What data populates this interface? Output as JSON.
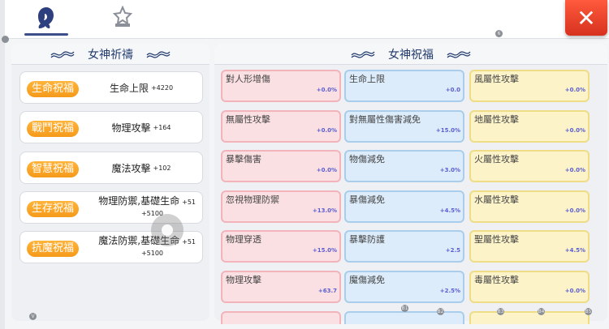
{
  "close_label": "✕",
  "left_panel": {
    "title": "女神祈禱",
    "rows": [
      {
        "badge": "生命祝福",
        "stat": "生命上限",
        "value": "+4220"
      },
      {
        "badge": "戰鬥祝福",
        "stat": "物理攻擊",
        "value": "+164"
      },
      {
        "badge": "智慧祝福",
        "stat": "魔法攻擊",
        "value": "+102"
      },
      {
        "badge": "生存祝福",
        "stat": "物理防禦,基礎生命",
        "value": "+51",
        "value2": "+5100"
      },
      {
        "badge": "抗魔祝福",
        "stat": "魔法防禦,基礎生命",
        "value": "+51",
        "value2": "+5100"
      }
    ]
  },
  "right_panel": {
    "title": "女神祝福",
    "columns": [
      [
        {
          "label": "對人形增傷",
          "value": "+0.0%"
        },
        {
          "label": "無屬性攻擊",
          "value": "+0.0%"
        },
        {
          "label": "暴擊傷害",
          "value": "+0.0%"
        },
        {
          "label": "忽視物理防禦",
          "value": "+13.0%"
        },
        {
          "label": "物理穿透",
          "value": "+15.0%"
        },
        {
          "label": "物理攻擊",
          "value": "+63.7"
        }
      ],
      [
        {
          "label": "生命上限",
          "value": "+0.0"
        },
        {
          "label": "對無屬性傷害減免",
          "value": "+15.0%"
        },
        {
          "label": "物傷減免",
          "value": "+3.0%"
        },
        {
          "label": "暴傷減免",
          "value": "+4.5%"
        },
        {
          "label": "暴擊防護",
          "value": "+2.5"
        },
        {
          "label": "魔傷減免",
          "value": "+2.5%"
        }
      ],
      [
        {
          "label": "風屬性攻擊",
          "value": "+0.0%"
        },
        {
          "label": "地屬性攻擊",
          "value": "+0.0%"
        },
        {
          "label": "火屬性攻擊",
          "value": "+0.0%"
        },
        {
          "label": "水屬性攻擊",
          "value": "+0.0%"
        },
        {
          "label": "聖屬性攻擊",
          "value": "+4.5%"
        },
        {
          "label": "毒屬性攻擊",
          "value": "+0.0%"
        }
      ]
    ]
  },
  "overlay_markers": [
    "6",
    "V",
    "B1",
    "B2",
    "B3",
    "B4",
    "B5"
  ],
  "colors": {
    "accent": "#3c4e8c",
    "badge": "#f59a1a",
    "close": "#d6321f",
    "value": "#5b5fd0"
  }
}
